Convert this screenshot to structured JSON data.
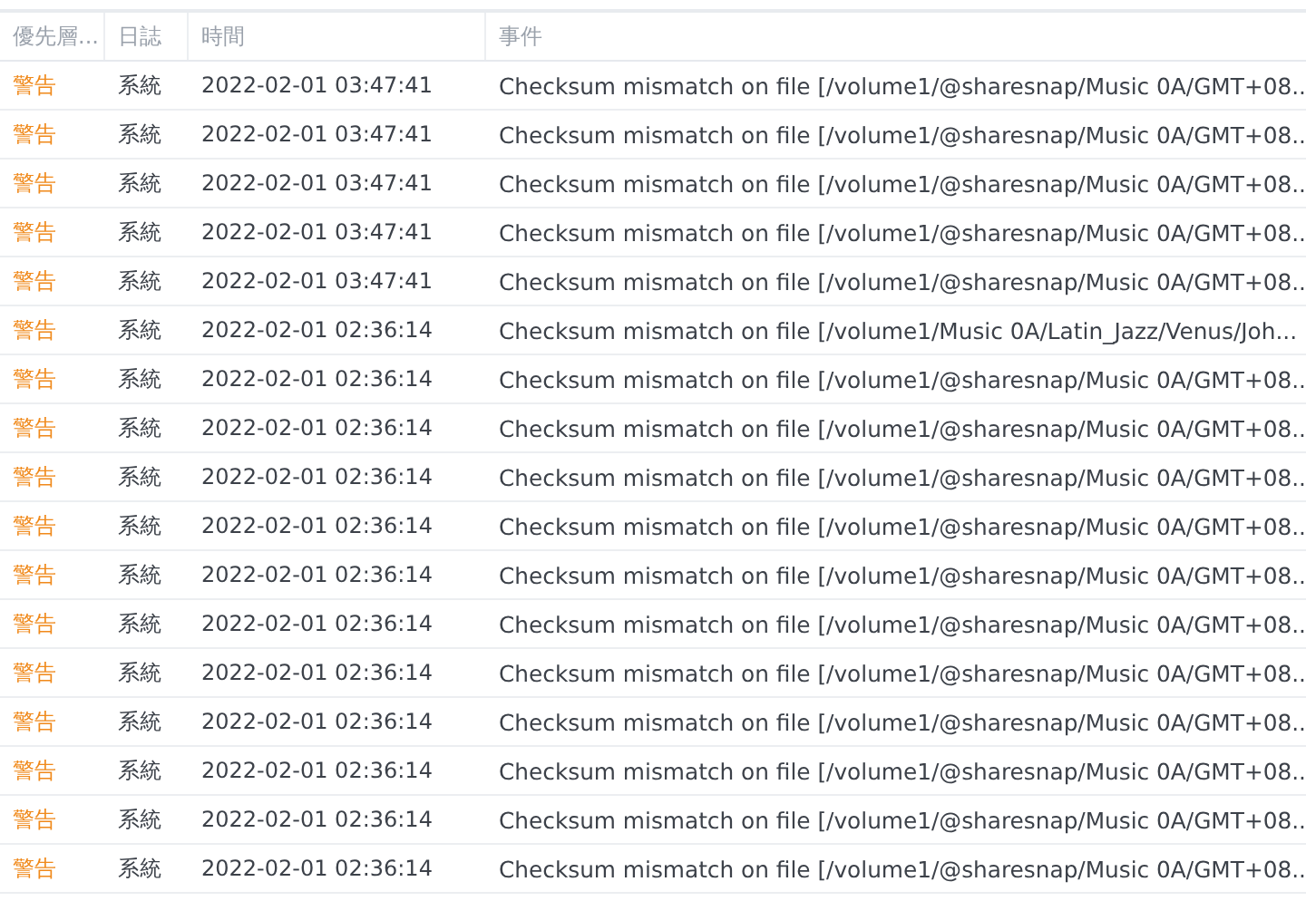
{
  "columns": [
    "優先層...",
    "日誌",
    "時間",
    "事件"
  ],
  "rows": [
    {
      "kind": "warning",
      "priority": "警告",
      "log": "系統",
      "time": "2022-02-01 03:47:41",
      "event": "Checksum mismatch on file [/volume1/@sharesnap/Music 0A/GMT+08..."
    },
    {
      "kind": "warning",
      "priority": "警告",
      "log": "系統",
      "time": "2022-02-01 03:47:41",
      "event": "Checksum mismatch on file [/volume1/@sharesnap/Music 0A/GMT+08..."
    },
    {
      "kind": "warning",
      "priority": "警告",
      "log": "系統",
      "time": "2022-02-01 03:47:41",
      "event": "Checksum mismatch on file [/volume1/@sharesnap/Music 0A/GMT+08..."
    },
    {
      "kind": "warning",
      "priority": "警告",
      "log": "系統",
      "time": "2022-02-01 03:47:41",
      "event": "Checksum mismatch on file [/volume1/@sharesnap/Music 0A/GMT+08..."
    },
    {
      "kind": "warning",
      "priority": "警告",
      "log": "系統",
      "time": "2022-02-01 03:47:41",
      "event": "Checksum mismatch on file [/volume1/@sharesnap/Music 0A/GMT+08..."
    },
    {
      "kind": "warning",
      "priority": "警告",
      "log": "系統",
      "time": "2022-02-01 02:36:14",
      "event": "Checksum mismatch on file [/volume1/Music 0A/Latin_Jazz/Venus/Joh..."
    },
    {
      "kind": "warning",
      "priority": "警告",
      "log": "系統",
      "time": "2022-02-01 02:36:14",
      "event": "Checksum mismatch on file [/volume1/@sharesnap/Music 0A/GMT+08..."
    },
    {
      "kind": "warning",
      "priority": "警告",
      "log": "系統",
      "time": "2022-02-01 02:36:14",
      "event": "Checksum mismatch on file [/volume1/@sharesnap/Music 0A/GMT+08..."
    },
    {
      "kind": "warning",
      "priority": "警告",
      "log": "系統",
      "time": "2022-02-01 02:36:14",
      "event": "Checksum mismatch on file [/volume1/@sharesnap/Music 0A/GMT+08..."
    },
    {
      "kind": "warning",
      "priority": "警告",
      "log": "系統",
      "time": "2022-02-01 02:36:14",
      "event": "Checksum mismatch on file [/volume1/@sharesnap/Music 0A/GMT+08..."
    },
    {
      "kind": "warning",
      "priority": "警告",
      "log": "系統",
      "time": "2022-02-01 02:36:14",
      "event": "Checksum mismatch on file [/volume1/@sharesnap/Music 0A/GMT+08..."
    },
    {
      "kind": "warning",
      "priority": "警告",
      "log": "系統",
      "time": "2022-02-01 02:36:14",
      "event": "Checksum mismatch on file [/volume1/@sharesnap/Music 0A/GMT+08..."
    },
    {
      "kind": "warning",
      "priority": "警告",
      "log": "系統",
      "time": "2022-02-01 02:36:14",
      "event": "Checksum mismatch on file [/volume1/@sharesnap/Music 0A/GMT+08..."
    },
    {
      "kind": "warning",
      "priority": "警告",
      "log": "系統",
      "time": "2022-02-01 02:36:14",
      "event": "Checksum mismatch on file [/volume1/@sharesnap/Music 0A/GMT+08..."
    },
    {
      "kind": "warning",
      "priority": "警告",
      "log": "系統",
      "time": "2022-02-01 02:36:14",
      "event": "Checksum mismatch on file [/volume1/@sharesnap/Music 0A/GMT+08..."
    },
    {
      "kind": "warning",
      "priority": "警告",
      "log": "系統",
      "time": "2022-02-01 02:36:14",
      "event": "Checksum mismatch on file [/volume1/@sharesnap/Music 0A/GMT+08..."
    },
    {
      "kind": "warning",
      "priority": "警告",
      "log": "系統",
      "time": "2022-02-01 02:36:14",
      "event": "Checksum mismatch on file [/volume1/@sharesnap/Music 0A/GMT+08..."
    }
  ]
}
